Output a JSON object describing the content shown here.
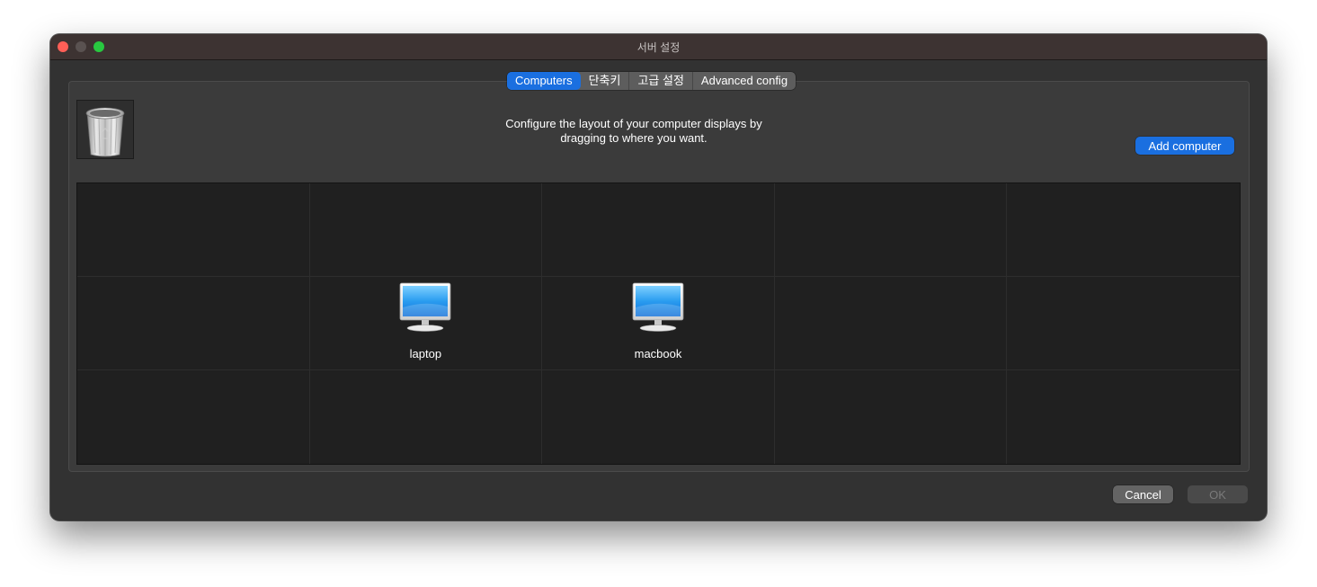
{
  "window": {
    "title": "서버 설정"
  },
  "tabs": [
    {
      "label": "Computers",
      "active": true
    },
    {
      "label": "단축키",
      "active": false
    },
    {
      "label": "고급 설정",
      "active": false
    },
    {
      "label": "Advanced config",
      "active": false
    }
  ],
  "panel": {
    "description_line1": "Configure the layout of your computer displays by",
    "description_line2": "dragging to where you want.",
    "add_button_label": "Add computer",
    "trash_icon": "trash-icon"
  },
  "grid": {
    "columns": 5,
    "rows": 3,
    "computers": [
      {
        "name": "laptop",
        "row": 1,
        "col": 1,
        "icon": "monitor-icon"
      },
      {
        "name": "macbook",
        "row": 1,
        "col": 2,
        "icon": "monitor-icon"
      }
    ]
  },
  "footer": {
    "cancel_label": "Cancel",
    "ok_label": "OK"
  },
  "colors": {
    "accent": "#1a6fe0",
    "window_bg": "#323232",
    "grid_bg": "#202020"
  }
}
